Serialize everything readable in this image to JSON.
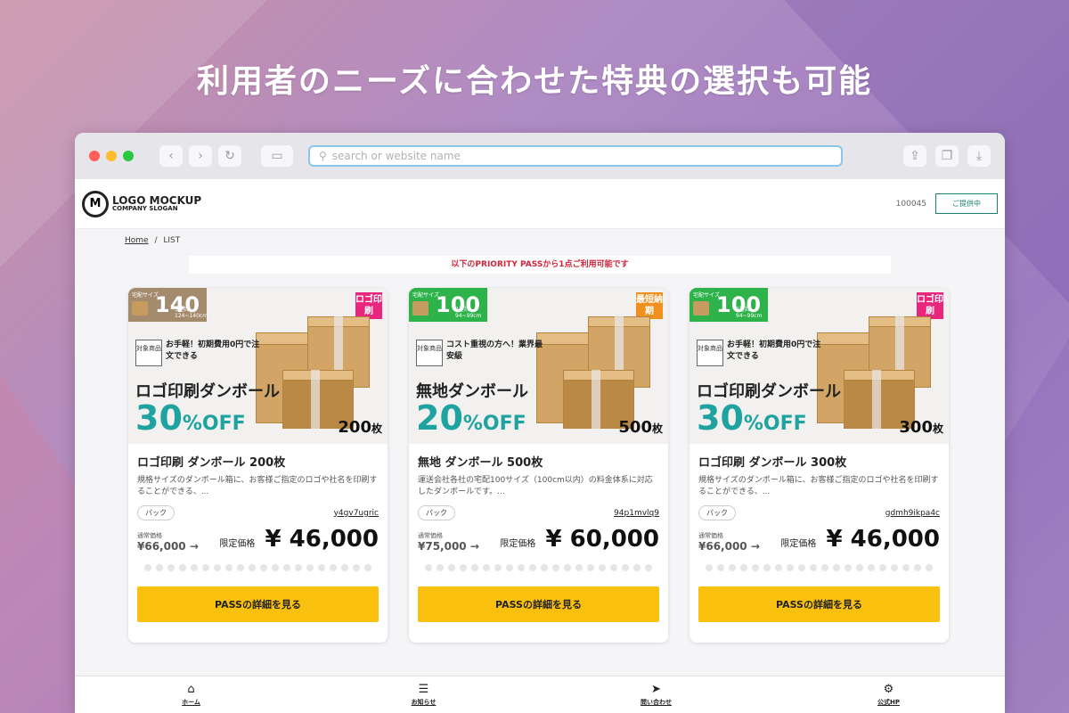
{
  "headline": "利用者のニーズに合わせた特典の選択も可能",
  "browser": {
    "url_placeholder": "search or website name"
  },
  "header": {
    "logo_main": "LOGO MOCKUP",
    "logo_sub": "COMPANY SLOGAN",
    "user_id": "100045",
    "status_button": "ご提供中"
  },
  "breadcrumb": {
    "home": "Home",
    "separator": "/",
    "current": "LIST"
  },
  "notice": "以下のPRIORITY PASSから1点ご利用可能です",
  "cards": [
    {
      "size_label": "宅配サイズ",
      "size": "140",
      "size_sub": "3辺計 124~140cm",
      "size_color": "#a58b6e",
      "corner_tag": "ロゴ印刷",
      "corner_color": "#e8267e",
      "target": "対象商品",
      "catch": "お手軽！初期費用0円で注文できる",
      "promo_title": "ロゴ印刷ダンボール",
      "discount": "30",
      "discount_unit": "%OFF",
      "qty": "200",
      "qty_unit": "枚",
      "title": "ロゴ印刷 ダンボール 200枚",
      "desc": "規格サイズのダンボール箱に、お客様ご指定のロゴや社名を印刷することができる、...",
      "tag": "パック",
      "code": "y4gv7ugric",
      "regular_label": "通常価格",
      "regular_price": "¥66,000 →",
      "sale_label": "限定価格",
      "sale_price": "¥ 46,000",
      "button": "PASSの詳細を見る"
    },
    {
      "size_label": "宅配サイズ",
      "size": "100",
      "size_sub": "3辺計 94~99cm",
      "size_color": "#2db34a",
      "corner_tag": "最短納期",
      "corner_color": "#f0901e",
      "target": "対象商品",
      "catch": "コスト重視の方へ！業界最安級",
      "promo_title": "無地ダンボール",
      "discount": "20",
      "discount_unit": "%OFF",
      "qty": "500",
      "qty_unit": "枚",
      "title": "無地 ダンボール 500枚",
      "desc": "運送会社各社の宅配100サイズ（100cm以内）の料金体系に対応したダンボールです。...",
      "tag": "パック",
      "code": "94p1mvlq9",
      "regular_label": "通常価格",
      "regular_price": "¥75,000 →",
      "sale_label": "限定価格",
      "sale_price": "¥ 60,000",
      "button": "PASSの詳細を見る"
    },
    {
      "size_label": "宅配サイズ",
      "size": "100",
      "size_sub": "3辺計 94~99cm",
      "size_color": "#2db34a",
      "corner_tag": "ロゴ印刷",
      "corner_color": "#e8267e",
      "target": "対象商品",
      "catch": "お手軽！初期費用0円で注文できる",
      "promo_title": "ロゴ印刷ダンボール",
      "discount": "30",
      "discount_unit": "%OFF",
      "qty": "300",
      "qty_unit": "枚",
      "title": "ロゴ印刷 ダンボール 300枚",
      "desc": "規格サイズのダンボール箱に、お客様ご指定のロゴや社名を印刷することができる、...",
      "tag": "パック",
      "code": "gdmh9ikpa4c",
      "regular_label": "通常価格",
      "regular_price": "¥66,000 →",
      "sale_label": "限定価格",
      "sale_price": "¥ 46,000",
      "button": "PASSの詳細を見る"
    }
  ],
  "bottom_nav": [
    {
      "label": "ホーム",
      "icon": "home-icon",
      "glyph": "⌂"
    },
    {
      "label": "お知らせ",
      "icon": "list-icon",
      "glyph": "☰"
    },
    {
      "label": "問い合わせ",
      "icon": "send-icon",
      "glyph": "➤"
    },
    {
      "label": "公式HP",
      "icon": "gear-icon",
      "glyph": "⚙"
    }
  ]
}
